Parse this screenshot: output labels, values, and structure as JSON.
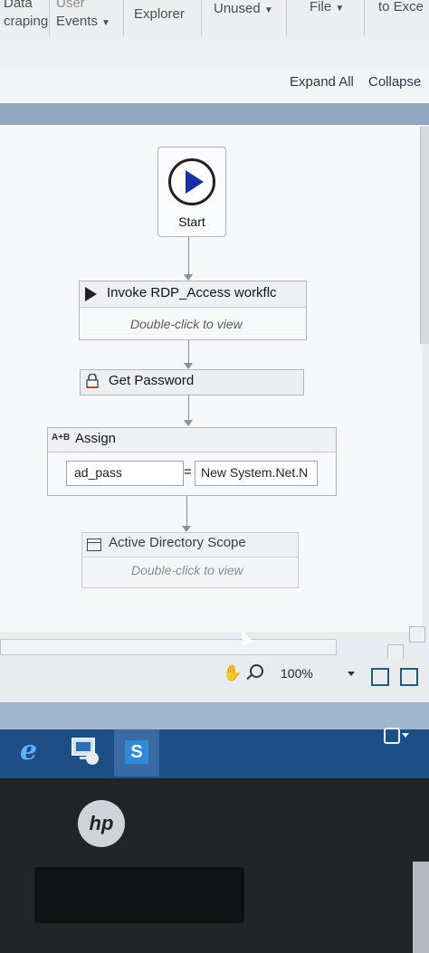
{
  "ribbon": {
    "items": [
      {
        "top": "Data",
        "bottom": "craping"
      },
      {
        "top": "User",
        "bottom": "Events",
        "dropdown": true
      },
      {
        "top": "",
        "bottom": "Explorer"
      },
      {
        "top": "",
        "bottom": "Unused",
        "dropdown": true
      },
      {
        "top": "",
        "bottom": "File",
        "dropdown": true
      },
      {
        "top": "",
        "bottom": "to Exce"
      }
    ]
  },
  "designer_header": {
    "expand_all": "Expand All",
    "collapse_all": "Collapse"
  },
  "workflow": {
    "start_label": "Start",
    "activities": [
      {
        "name": "Invoke RDP_Access workflc",
        "hint": "Double-click to view",
        "icon": "invoke-icon"
      },
      {
        "name": "Get Password",
        "icon": "lock-icon"
      },
      {
        "name": "Assign",
        "icon": "ab-icon",
        "icon_text": "A+B",
        "to": "ad_pass",
        "operator": "=",
        "value": "New System.Net.N"
      },
      {
        "name": "Active Directory Scope",
        "hint": "Double-click to view",
        "icon": "ads-icon"
      }
    ]
  },
  "status_bar": {
    "zoom": "100%",
    "icons": [
      "hand-icon",
      "zoom-icon",
      "fit-to-screen-icon",
      "full-screen-icon"
    ]
  },
  "taskbar": {
    "icons": [
      "internet-explorer-icon",
      "remote-desktop-icon",
      "studio-icon"
    ],
    "studio_glyph": "S"
  },
  "monitor": {
    "brand": "hp"
  }
}
